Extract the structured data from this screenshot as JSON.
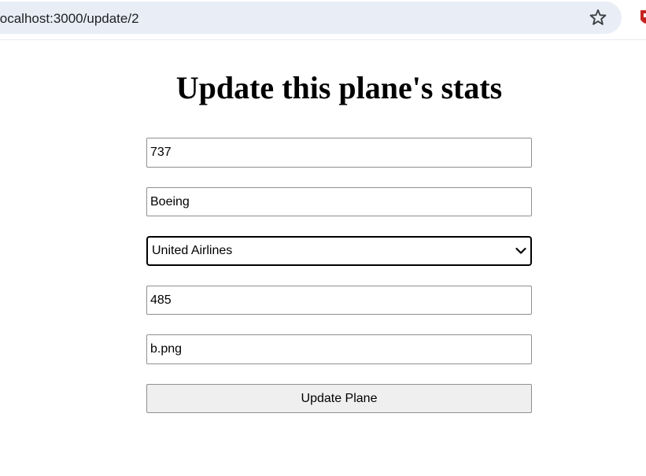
{
  "browser": {
    "url": "localhost:3000/update/2",
    "bookmark_icon": "star-icon",
    "extension_icon": "shield-icon"
  },
  "page": {
    "title": "Update this plane's stats"
  },
  "form": {
    "model": {
      "value": "737"
    },
    "manufacturer": {
      "value": "Boeing"
    },
    "airline": {
      "selected": "United Airlines",
      "dropdown_icon": "chevron-down-icon"
    },
    "capacity": {
      "value": "485"
    },
    "image": {
      "value": "b.png"
    },
    "submit_label": "Update Plane"
  },
  "colors": {
    "address_bar_bg": "#e9edf6",
    "button_bg": "#efefef",
    "field_border": "#8f8f8f",
    "focused_border": "#000000",
    "extension_red": "#c5221f"
  }
}
